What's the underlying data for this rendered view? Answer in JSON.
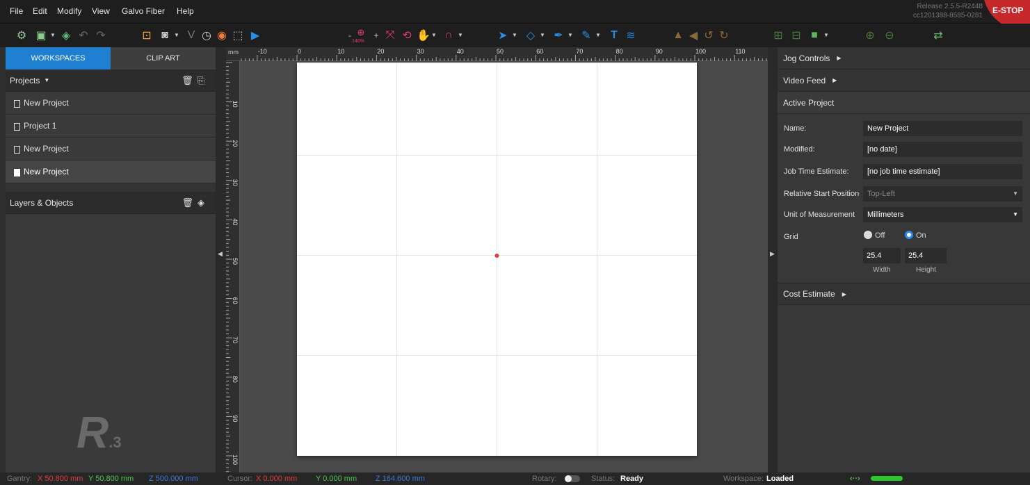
{
  "menu": [
    "File",
    "Edit",
    "Modify",
    "View",
    "Galvo Fiber",
    "Help"
  ],
  "release": {
    "line1": "Release 2.5.5-R2448",
    "line2": "cc1201388-8585-0281"
  },
  "estop_label": "E-STOP",
  "zoom_level": "146%",
  "left_tabs": {
    "workspaces": "WORKSPACES",
    "clipart": "CLIP ART"
  },
  "projects": {
    "header": "Projects",
    "items": [
      "New Project",
      "Project 1",
      "New Project",
      "New Project"
    ],
    "selected_index": 3
  },
  "layers": {
    "header": "Layers & Objects"
  },
  "logo": {
    "text": "R",
    "super": ".3"
  },
  "ruler": {
    "unit": "mm",
    "h_ticks": [
      "-10",
      "0",
      "10",
      "20",
      "30",
      "40",
      "50",
      "60",
      "70",
      "80",
      "90",
      "100",
      "110"
    ],
    "v_ticks": [
      "10",
      "20",
      "30",
      "40",
      "50",
      "60",
      "70",
      "80",
      "90",
      "100"
    ]
  },
  "right": {
    "jog": "Jog Controls",
    "video": "Video Feed",
    "active": "Active Project",
    "name_label": "Name:",
    "name_value": "New Project",
    "modified_label": "Modified:",
    "modified_value": "[no date]",
    "jobtime_label": "Job Time Estimate:",
    "jobtime_value": "[no job time estimate]",
    "relstart_label": "Relative Start Position",
    "relstart_value": "Top-Left",
    "unit_label": "Unit of Measurement",
    "unit_value": "Millimeters",
    "grid_label": "Grid",
    "grid_off": "Off",
    "grid_on": "On",
    "grid_width": "25.4",
    "grid_height": "25.4",
    "width_label": "Width",
    "height_label": "Height",
    "cost": "Cost Estimate"
  },
  "status": {
    "gantry_label": "Gantry:",
    "gantry_x": "X 50.800 mm",
    "gantry_y": "Y 50.800 mm",
    "gantry_z": "Z 500.000 mm",
    "cursor_label": "Cursor:",
    "cursor_x": "X 0.000 mm",
    "cursor_y": "Y 0.000 mm",
    "cursor_z": "Z 164.600 mm",
    "rotary_label": "Rotary:",
    "status_label": "Status:",
    "status_value": "Ready",
    "workspace_label": "Workspace:",
    "workspace_value": "Loaded"
  },
  "colors": {
    "accent": "#1f7fd0",
    "estop": "#c6282b",
    "connected": "#2fc52f"
  }
}
